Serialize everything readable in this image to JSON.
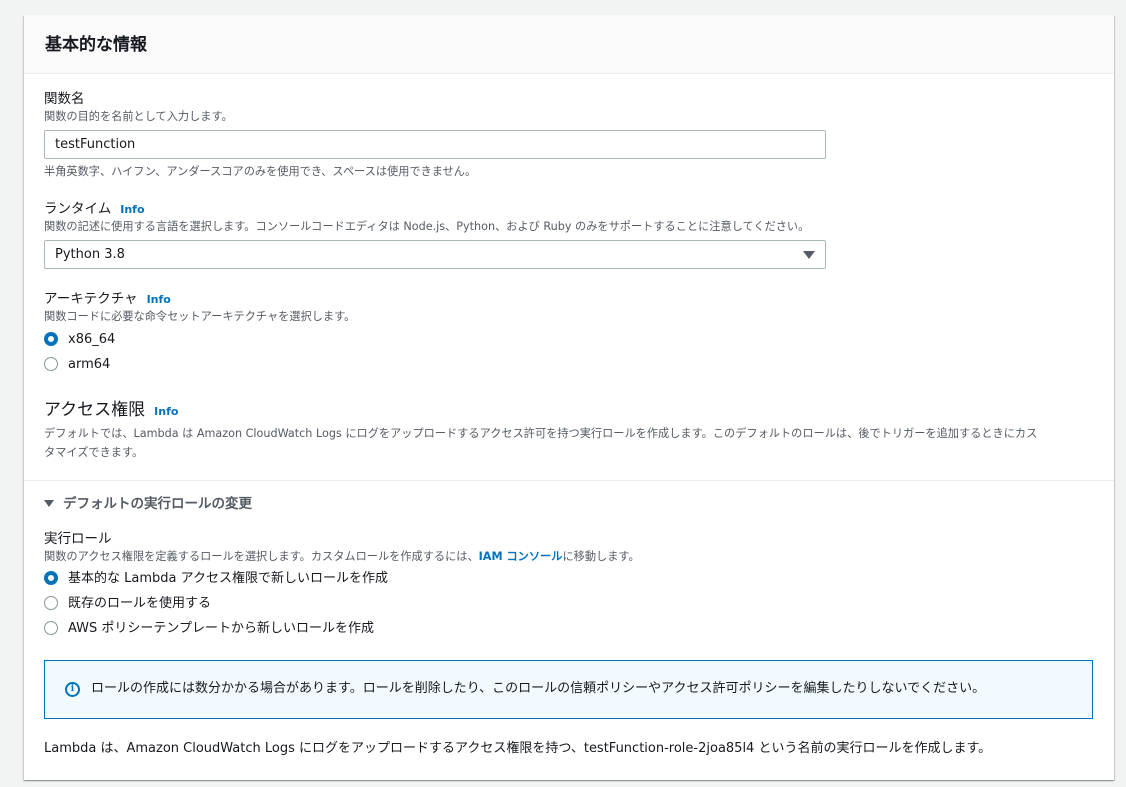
{
  "panel": {
    "title": "基本的な情報"
  },
  "function_name": {
    "label": "関数名",
    "description": "関数の目的を名前として入力します。",
    "value": "testFunction",
    "constraint": "半角英数字、ハイフン、アンダースコアのみを使用でき、スペースは使用できません。"
  },
  "runtime": {
    "label": "ランタイム",
    "info": "Info",
    "description": "関数の記述に使用する言語を選択します。コンソールコードエディタは Node.js、Python、および Ruby のみをサポートすることに注意してください。",
    "selected": "Python 3.8"
  },
  "architecture": {
    "label": "アーキテクチャ",
    "info": "Info",
    "description": "関数コードに必要な命令セットアーキテクチャを選択します。",
    "options": [
      {
        "label": "x86_64",
        "checked": true
      },
      {
        "label": "arm64",
        "checked": false
      }
    ]
  },
  "permissions": {
    "title": "アクセス権限",
    "info": "Info",
    "description_line1": "デフォルトでは、Lambda は Amazon CloudWatch Logs にログをアップロードするアクセス許可を持つ実行ロールを作成します。このデフォルトのロールは、後でトリガーを追加するときにカス",
    "description_line2": "タマイズできます。"
  },
  "execution_role_section": {
    "expander_label": "デフォルトの実行ロールの変更",
    "label": "実行ロール",
    "description_before": "関数のアクセス権限を定義するロールを選択します。カスタムロールを作成するには、",
    "description_link": "IAM コンソール",
    "description_after": "に移動します。",
    "options": [
      {
        "label": "基本的な Lambda アクセス権限で新しいロールを作成",
        "checked": true
      },
      {
        "label": "既存のロールを使用する",
        "checked": false
      },
      {
        "label": "AWS ポリシーテンプレートから新しいロールを作成",
        "checked": false
      }
    ],
    "alert": "ロールの作成には数分かかる場合があります。ロールを削除したり、このロールの信頼ポリシーやアクセス許可ポリシーを編集したりしないでください。",
    "footer": "Lambda は、Amazon CloudWatch Logs にログをアップロードするアクセス権限を持つ、testFunction-role-2joa85l4 という名前の実行ロールを作成します。"
  },
  "colors": {
    "accent": "#0073bb",
    "alert_bg": "#f1faff",
    "text_secondary": "#545b64"
  }
}
